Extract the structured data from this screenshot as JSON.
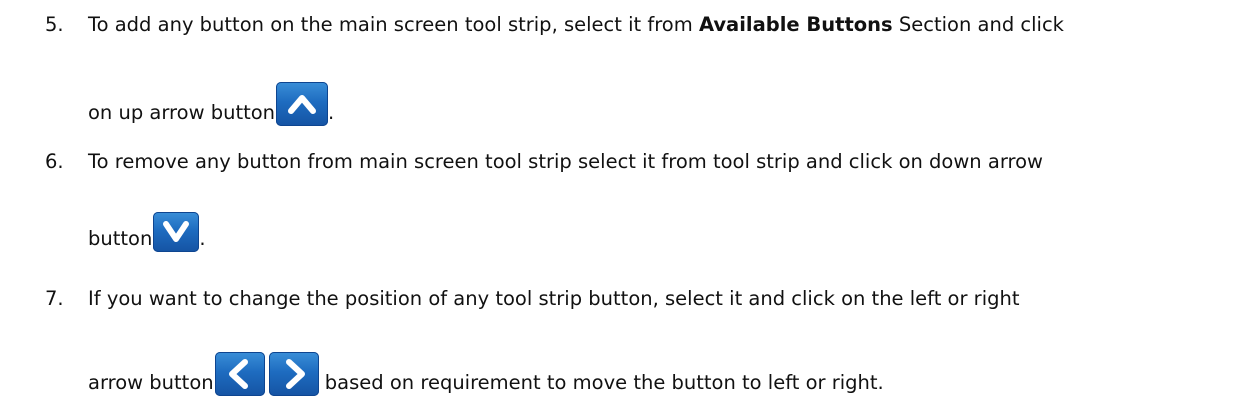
{
  "steps": [
    {
      "number": "5.",
      "line1_before": "To add any button on the main screen tool strip, select it from ",
      "line1_bold": "Available Buttons",
      "line1_after": " Section and click",
      "line2_before": "on up arrow button",
      "line2_after": ".",
      "icon": "up-arrow-icon"
    },
    {
      "number": "6.",
      "line1": "To remove any button from main screen tool strip select it from tool strip and click on down arrow",
      "line2_before": "button",
      "line2_after": ".",
      "icon": "down-arrow-icon"
    },
    {
      "number": "7.",
      "line1": "If you want to change the position of any tool strip button, select it and click on the left or right",
      "line2_before": "arrow button",
      "line2_after": " based on requirement to move the button to left or right.",
      "icons": [
        "left-arrow-icon",
        "right-arrow-icon"
      ]
    }
  ],
  "colors": {
    "icon_blue": "#1e6cc0",
    "text": "#111111"
  }
}
